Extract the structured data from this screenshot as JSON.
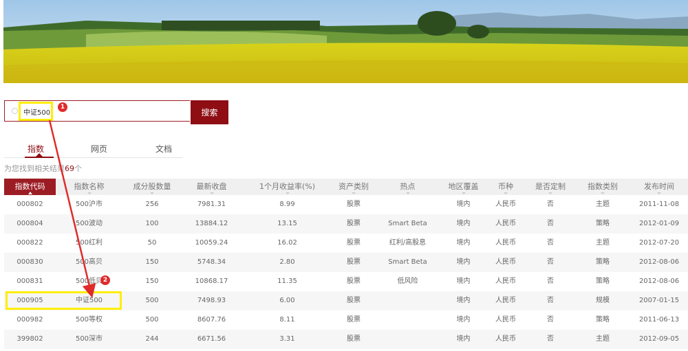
{
  "search": {
    "value": "中证500",
    "button_label": "搜索"
  },
  "tabs": [
    {
      "label": "指数",
      "active": true
    },
    {
      "label": "网页",
      "active": false
    },
    {
      "label": "文档",
      "active": false
    }
  ],
  "result_count": {
    "prefix": "为您找到相关结果",
    "count": "69",
    "suffix": "个"
  },
  "table": {
    "columns": [
      "指数代码",
      "指数名称",
      "成分股数量",
      "最新收盘",
      "1个月收益率(%)",
      "资产类别",
      "热点",
      "地区覆盖",
      "币种",
      "是否定制",
      "指数类别",
      "发布时间"
    ],
    "sorted_column": "指数代码",
    "rows": [
      [
        "000802",
        "500沪市",
        "256",
        "7981.31",
        "8.99",
        "股票",
        "",
        "境内",
        "人民币",
        "否",
        "主题",
        "2011-11-08"
      ],
      [
        "000804",
        "500波动",
        "100",
        "13884.12",
        "13.15",
        "股票",
        "Smart Beta",
        "境内",
        "人民币",
        "否",
        "策略",
        "2012-01-09"
      ],
      [
        "000822",
        "500红利",
        "50",
        "10059.24",
        "16.02",
        "股票",
        "红利/高股息",
        "境内",
        "人民币",
        "否",
        "主题",
        "2012-07-20"
      ],
      [
        "000830",
        "500高贝",
        "150",
        "5748.34",
        "2.80",
        "股票",
        "Smart Beta",
        "境内",
        "人民币",
        "否",
        "策略",
        "2012-08-06"
      ],
      [
        "000831",
        "500低贝",
        "150",
        "10868.17",
        "11.35",
        "股票",
        "低风险",
        "境内",
        "人民币",
        "否",
        "策略",
        "2012-08-06"
      ],
      [
        "000905",
        "中证500",
        "500",
        "7498.93",
        "6.00",
        "股票",
        "",
        "境内",
        "人民币",
        "否",
        "规模",
        "2007-01-15"
      ],
      [
        "000982",
        "500等权",
        "500",
        "8607.76",
        "8.11",
        "股票",
        "",
        "境内",
        "人民币",
        "否",
        "策略",
        "2011-06-13"
      ],
      [
        "399802",
        "500深市",
        "244",
        "6671.56",
        "3.31",
        "股票",
        "",
        "境内",
        "人民币",
        "否",
        "主题",
        "2012-09-05"
      ]
    ]
  },
  "annotations": [
    {
      "label": "1"
    },
    {
      "label": "2"
    }
  ],
  "colors": {
    "brand": "#8e0e13",
    "highlight": "#ffee00",
    "arrow": "#e02b2b"
  }
}
